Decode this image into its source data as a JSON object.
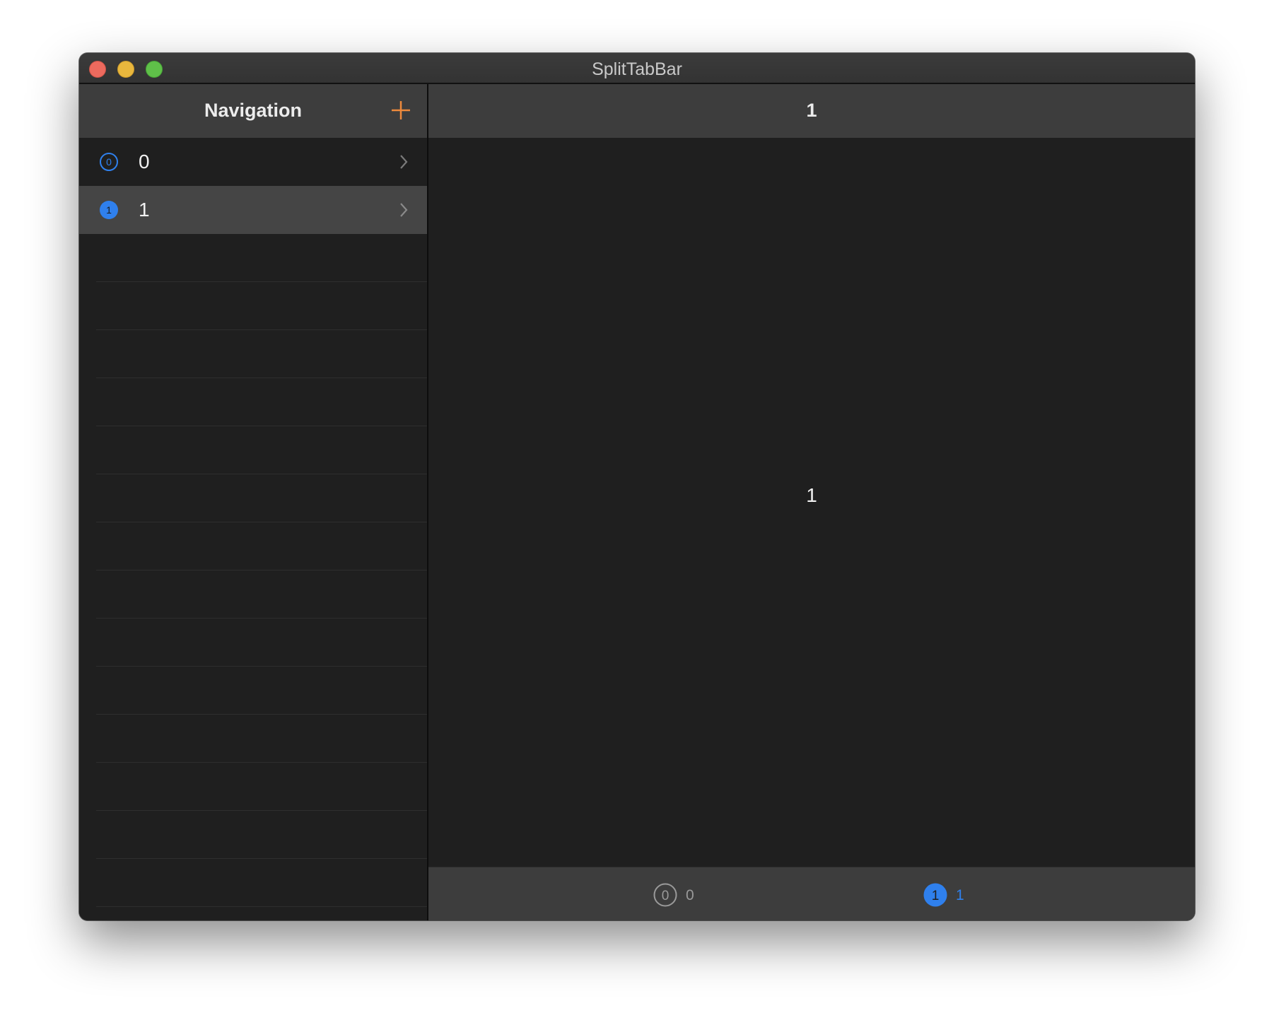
{
  "window": {
    "title": "SplitTabBar"
  },
  "sidebar": {
    "title": "Navigation",
    "add_icon": "plus-icon",
    "items": [
      {
        "label": "0",
        "icon": "circle-0-icon",
        "selected": false
      },
      {
        "label": "1",
        "icon": "circle-1-fill-icon",
        "selected": true
      }
    ]
  },
  "detail": {
    "title": "1",
    "content_text": "1"
  },
  "tabbar": {
    "tabs": [
      {
        "label": "0",
        "icon": "circle-0-icon",
        "selected": false
      },
      {
        "label": "1",
        "icon": "circle-1-fill-icon",
        "selected": true
      }
    ]
  },
  "colors": {
    "accent": "#ef8a3c",
    "tint": "#2f80ed",
    "inactive": "#9a9a9a"
  }
}
